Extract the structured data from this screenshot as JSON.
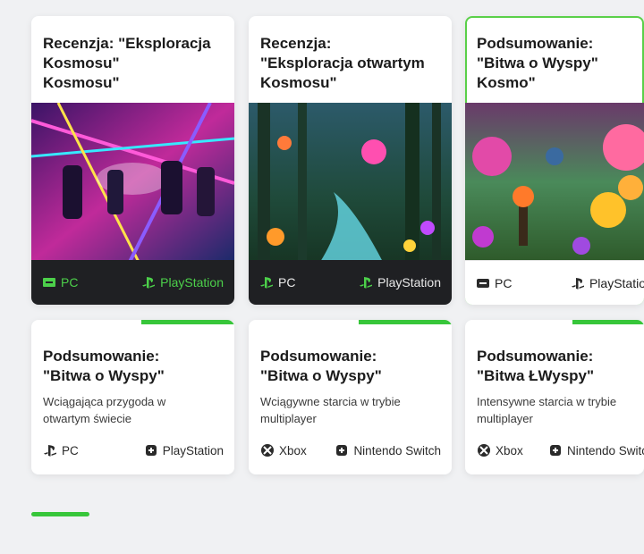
{
  "top_cards": [
    {
      "title": "Recenzja: \"Eksploracja\nKosmosu\"\nKosmosu\"",
      "platforms": [
        {
          "label": "PC",
          "icon": "monitor-icon"
        },
        {
          "label": "PlayStation",
          "icon": "playstation-icon"
        }
      ]
    },
    {
      "title": "Recenzja:\n\"Eksploracja otwartym\nKosmosu\"",
      "platforms": [
        {
          "label": "PC",
          "icon": "playstation-icon"
        },
        {
          "label": "PlayStation",
          "icon": "playstation-icon"
        }
      ]
    },
    {
      "title": "Podsumowanie:\n\"Bitwa o Wyspy\"\nKosmo\"",
      "platforms": [
        {
          "label": "PC",
          "icon": "monitor-icon"
        },
        {
          "label": "PlayStatio",
          "icon": "playstation-icon"
        }
      ]
    }
  ],
  "bottom_cards": [
    {
      "title": "Podsumowanie:\n\"Bitwa o Wyspy\"",
      "description": "Wciągająca przygoda w\notwartym świecie",
      "platforms": [
        {
          "label": "PC",
          "icon": "playstation-icon"
        },
        {
          "label": "PlayStation",
          "icon": "nintendo-switch-icon"
        }
      ]
    },
    {
      "title": "Podsumowanie:\n\"Bitwa o Wyspy\"",
      "description": "Wciągywne starcia w trybie\nmultiplayer",
      "platforms": [
        {
          "label": "Xbox",
          "icon": "xbox-icon"
        },
        {
          "label": "Nintendo Switch",
          "icon": "nintendo-switch-icon"
        }
      ]
    },
    {
      "title": "Podsumowanie:\n\"Bitwa ŁWyspy\"",
      "description": "Intensywne starcia w trybie\nmultiplayer",
      "platforms": [
        {
          "label": "Xbox",
          "icon": "xbox-icon"
        },
        {
          "label": "Nintendo Switc",
          "icon": "nintendo-switch-icon"
        }
      ]
    }
  ],
  "colors": {
    "accent": "#37c63a",
    "platform_green": "#4cd04a",
    "dark_bar": "#1f2023"
  }
}
